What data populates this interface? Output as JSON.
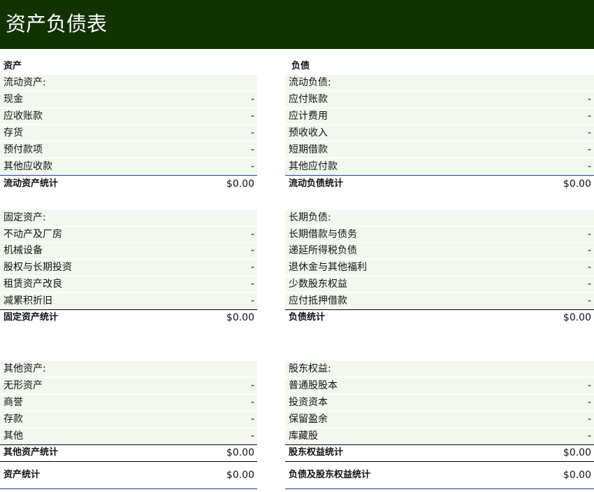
{
  "title": "资产负债表",
  "assets": {
    "header": "资产",
    "current": {
      "section_label": "流动资产:",
      "items": [
        {
          "label": "现金",
          "value": "-"
        },
        {
          "label": "应收账款",
          "value": "-"
        },
        {
          "label": "存货",
          "value": "-"
        },
        {
          "label": "预付款项",
          "value": "-"
        },
        {
          "label": "其他应收款",
          "value": "-"
        }
      ],
      "total_label": "流动资产统计",
      "total_value": "$0.00"
    },
    "fixed": {
      "section_label": "固定资产:",
      "items": [
        {
          "label": "不动产及厂房",
          "value": "-"
        },
        {
          "label": "机械设备",
          "value": "-"
        },
        {
          "label": "股权与长期投资",
          "value": "-"
        },
        {
          "label": "租赁资产改良",
          "value": "-"
        },
        {
          "label": "减累积折旧",
          "value": "-"
        }
      ],
      "total_label": "固定资产统计",
      "total_value": "$0.00"
    },
    "other": {
      "section_label": "其他资产:",
      "items": [
        {
          "label": "无形资产",
          "value": "-"
        },
        {
          "label": "商誉",
          "value": "-"
        },
        {
          "label": "存款",
          "value": "-"
        },
        {
          "label": "其他",
          "value": "-"
        }
      ],
      "total_label": "其他资产统计",
      "total_value": "$0.00"
    },
    "grand_total_label": "资产统计",
    "grand_total_value": "$0.00"
  },
  "liabilities": {
    "header": "负债",
    "current": {
      "section_label": "流动负债:",
      "items": [
        {
          "label": "应付账款",
          "value": "-"
        },
        {
          "label": "应计费用",
          "value": "-"
        },
        {
          "label": "预收收入",
          "value": "-"
        },
        {
          "label": "短期借款",
          "value": "-"
        },
        {
          "label": "其他应付款",
          "value": "-"
        }
      ],
      "total_label": "流动负债统计",
      "total_value": "$0.00"
    },
    "longterm": {
      "section_label": "长期负债:",
      "items": [
        {
          "label": "长期借款与债务",
          "value": "-"
        },
        {
          "label": "递延所得税负债",
          "value": "-"
        },
        {
          "label": "退休金与其他福利",
          "value": "-"
        },
        {
          "label": "少数股东权益",
          "value": "-"
        },
        {
          "label": "应付抵押借款",
          "value": "-"
        }
      ],
      "total_label": "负债统计",
      "total_value": "$0.00"
    },
    "equity": {
      "section_label": "股东权益:",
      "items": [
        {
          "label": "普通股股本",
          "value": "-"
        },
        {
          "label": "投资资本",
          "value": "-"
        },
        {
          "label": "保留盈余",
          "value": "-"
        },
        {
          "label": "库藏股",
          "value": "-"
        }
      ],
      "total_label": "股东权益统计",
      "total_value": "$0.00"
    },
    "grand_total_label": "负债及股东权益统计",
    "grand_total_value": "$0.00"
  }
}
